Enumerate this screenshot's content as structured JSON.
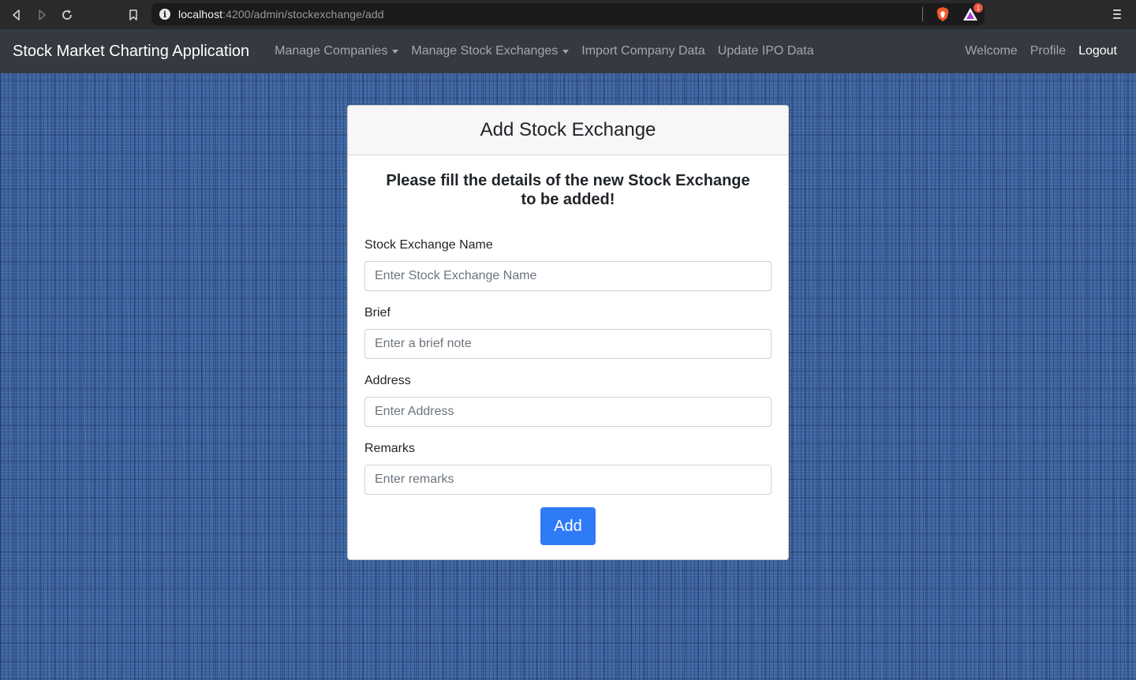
{
  "browser": {
    "url_host": "localhost",
    "url_path": ":4200/admin/stockexchange/add",
    "rewards_badge": "1"
  },
  "navbar": {
    "brand": "Stock Market Charting Application",
    "links": [
      {
        "label": "Manage Companies",
        "dropdown": true
      },
      {
        "label": "Manage Stock Exchanges",
        "dropdown": true
      },
      {
        "label": "Import Company Data",
        "dropdown": false
      },
      {
        "label": "Update IPO Data",
        "dropdown": false
      }
    ],
    "right_links": [
      {
        "label": "Welcome"
      },
      {
        "label": "Profile"
      },
      {
        "label": "Logout"
      }
    ]
  },
  "card": {
    "title": "Add Stock Exchange",
    "subtitle": "Please fill the details of the new Stock Exchange to be added!",
    "fields": [
      {
        "label": "Stock Exchange Name",
        "placeholder": "Enter Stock Exchange Name",
        "value": ""
      },
      {
        "label": "Brief",
        "placeholder": "Enter a brief note",
        "value": ""
      },
      {
        "label": "Address",
        "placeholder": "Enter Address",
        "value": ""
      },
      {
        "label": "Remarks",
        "placeholder": "Enter remarks",
        "value": ""
      }
    ],
    "submit_label": "Add"
  },
  "colors": {
    "navbar_bg": "#343a40",
    "primary": "#2f7af6",
    "background": "#3d64a0"
  }
}
